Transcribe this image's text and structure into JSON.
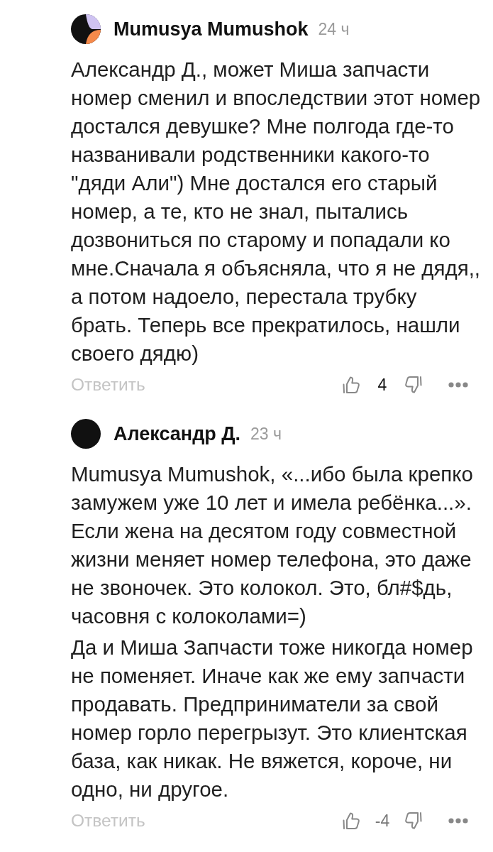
{
  "comments": [
    {
      "avatar": {
        "kind": "tricolor"
      },
      "author": "Mumusya Mumushok",
      "time": "24 ч",
      "paragraphs": [
        "Александр Д., может Миша запчасти номер сменил и впоследствии этот номер достался девушке? Мне полгода где-то названивали родственники какого-то \"дяди Али\") Мне достался его старый номер, а те, кто не знал, пытались дозвониться по старому и попадали ко мне.Сначала я объясняла, что я не дядя,, а потом надоело, перестала трубку брать. Теперь все прекратилось, нашли своего дядю)"
      ],
      "reply": "Ответить",
      "score": "4",
      "score_positive": true
    },
    {
      "avatar": {
        "kind": "plain"
      },
      "author": "Александр Д.",
      "time": "23 ч",
      "paragraphs": [
        "Mumusya Mumushok, «...ибо была крепко замужем уже 10 лет и имела ребёнка...». Если жена на десятом году совместной жизни меняет номер телефона, это даже не звоночек. Это колокол. Это, бл#$дь, часовня с колоколами=)",
        "Да и Миша Запчасти тоже никогда номер не поменяет. Иначе как же ему запчасти продавать. Предприниматели за свой номер горло перегрызут. Это клиентская база, как никак. Не вяжется, короче, ни одно, ни другое."
      ],
      "reply": "Ответить",
      "score": "-4",
      "score_positive": false
    }
  ]
}
